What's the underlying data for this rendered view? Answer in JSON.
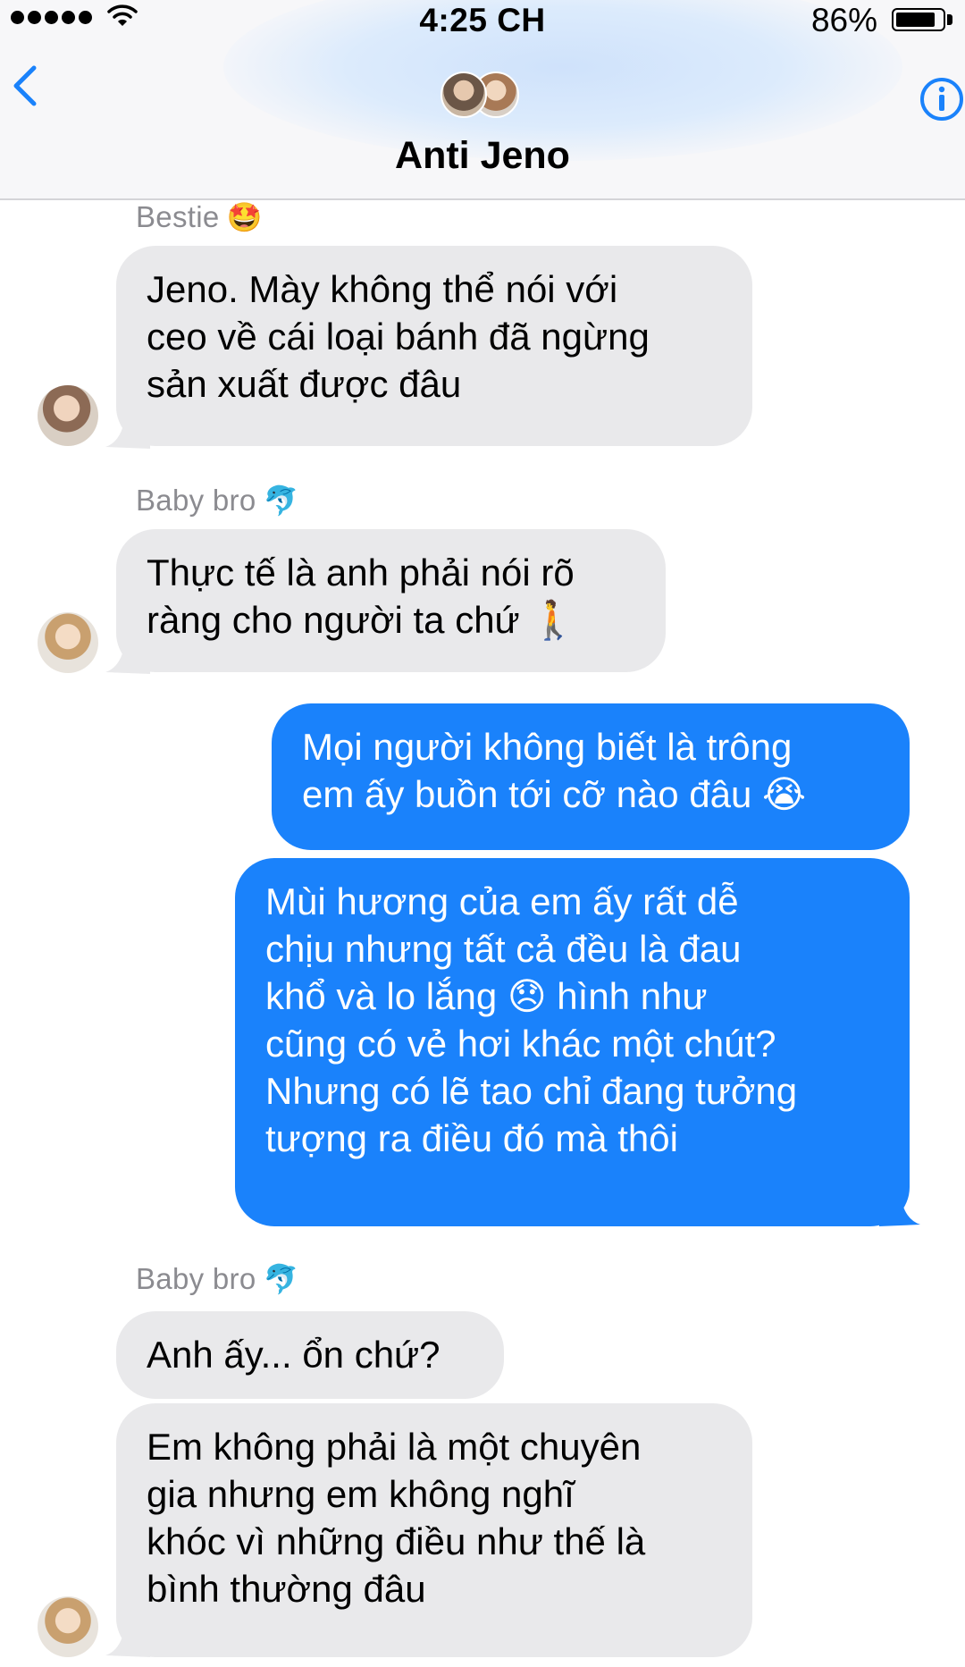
{
  "status_bar": {
    "time": "4:25 CH",
    "battery": "86%",
    "battery_level": 0.86
  },
  "header": {
    "title": "Anti Jeno"
  },
  "messages": [
    {
      "sender": "Bestie",
      "sender_emoji": "🤩",
      "text": "Jeno. Mày không thể nói với\nceo về cái loại bánh đã ngừng\nsản xuất được đâu"
    },
    {
      "sender": "Baby bro",
      "sender_emoji": "🐬",
      "text": "Thực tế là anh phải nói rõ\nràng cho người ta chứ 🚶"
    },
    {
      "text": "Mọi người không biết là trông\nem ấy buồn tới cỡ nào đâu 😭"
    },
    {
      "text": "Mùi hương của em ấy rất dễ\nchịu nhưng tất cả đều là đau\nkhổ và lo lắng 😞 hình như\ncũng có vẻ hơi khác một chút?\nNhưng có lẽ tao chỉ đang tưởng\ntượng ra điều đó mà thôi"
    },
    {
      "sender": "Baby bro",
      "sender_emoji": "🐬",
      "text": "Anh ấy... ổn chứ?"
    },
    {
      "text": "Em không phải là một chuyên\ngia nhưng em không nghĩ\nkhóc vì những điều như thế là\nbình thường đâu"
    }
  ],
  "colors": {
    "incoming": "#e9e9eb",
    "outgoing": "#1a82fb",
    "accent": "#1a82fb"
  },
  "icons": {
    "back": "chevron-left-icon",
    "info": "info-icon",
    "signal": "signal-dots-icon",
    "wifi": "wifi-icon",
    "battery": "battery-icon"
  }
}
